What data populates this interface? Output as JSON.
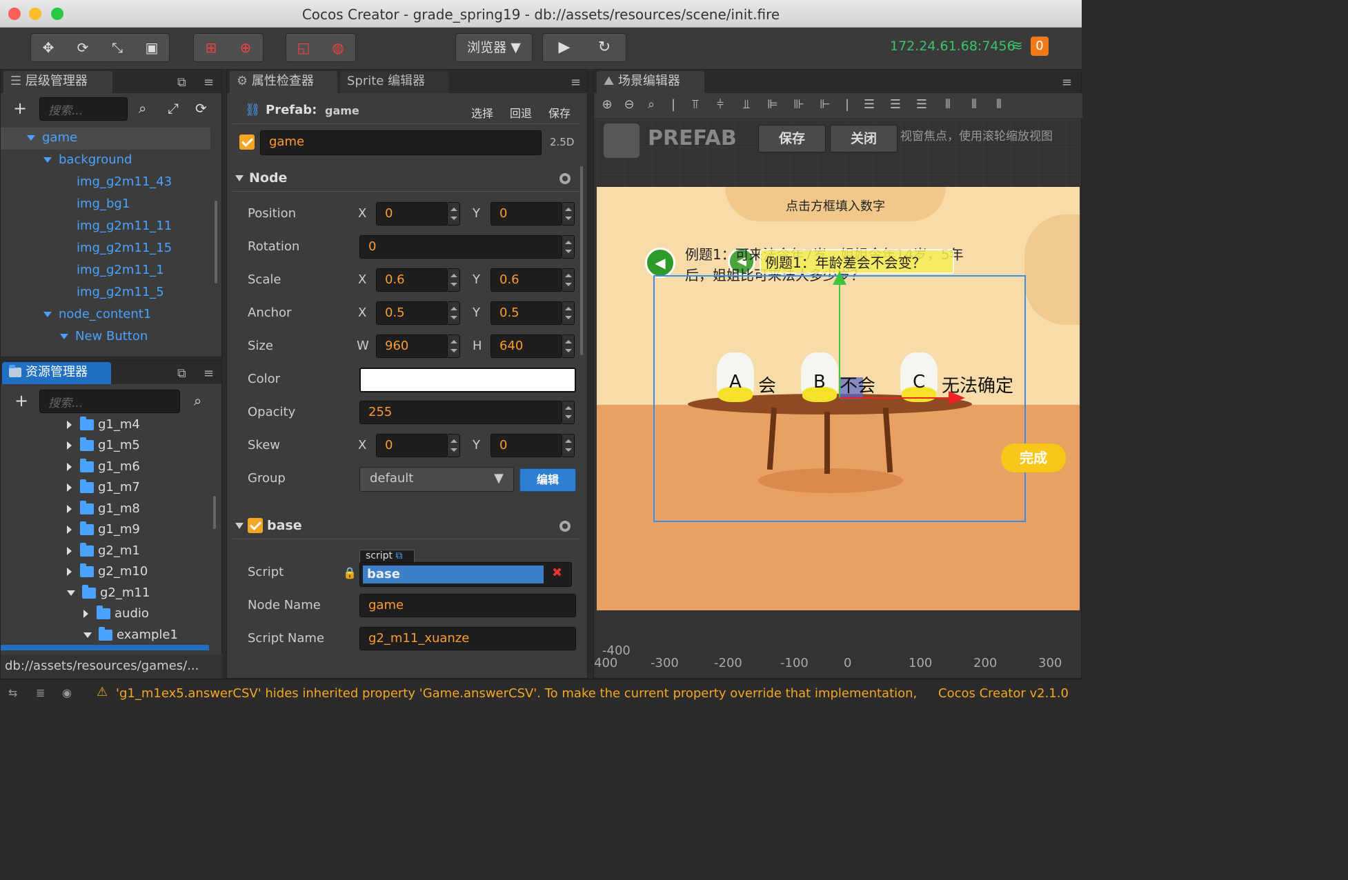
{
  "window": {
    "title": "Cocos Creator - grade_spring19 - db://assets/resources/scene/init.fire"
  },
  "toolbar": {
    "preview_select": "浏览器 ▼",
    "ip_address": "172.24.61.68:7456",
    "notification_count": "0"
  },
  "hierarchy": {
    "tab_label": "层级管理器",
    "search_placeholder": "搜索...",
    "items": [
      {
        "label": "game"
      },
      {
        "label": "background"
      },
      {
        "label": "img_g2m11_43"
      },
      {
        "label": "img_bg1"
      },
      {
        "label": "img_g2m11_11"
      },
      {
        "label": "img_g2m11_15"
      },
      {
        "label": "img_g2m11_1"
      },
      {
        "label": "img_g2m11_5"
      },
      {
        "label": "node_content1"
      },
      {
        "label": "New Button"
      }
    ]
  },
  "assets": {
    "tab_label": "资源管理器",
    "search_placeholder": "搜索...",
    "items": [
      {
        "label": "g1_m4"
      },
      {
        "label": "g1_m5"
      },
      {
        "label": "g1_m6"
      },
      {
        "label": "g1_m7"
      },
      {
        "label": "g1_m8"
      },
      {
        "label": "g1_m9"
      },
      {
        "label": "g2_m1"
      },
      {
        "label": "g2_m10"
      },
      {
        "label": "g2_m11"
      },
      {
        "label": "audio"
      },
      {
        "label": "example1"
      }
    ],
    "path": "db://assets/resources/games/..."
  },
  "inspector": {
    "tab_label": "属性检查器",
    "tab2_label": "Sprite 编辑器",
    "prefab_label": "Prefab:",
    "prefab_name": "game",
    "prefab_actions": {
      "select": "选择",
      "revert": "回退",
      "save": "保存"
    },
    "node_name": "game",
    "mode_25d": "2.5D",
    "node_section": "Node",
    "props": {
      "position": {
        "label": "Position",
        "x": "0",
        "y": "0"
      },
      "rotation": {
        "label": "Rotation",
        "value": "0"
      },
      "scale": {
        "label": "Scale",
        "x": "0.6",
        "y": "0.6"
      },
      "anchor": {
        "label": "Anchor",
        "x": "0.5",
        "y": "0.5"
      },
      "size": {
        "label": "Size",
        "w": "960",
        "h": "640"
      },
      "color": {
        "label": "Color",
        "value": "#ffffff"
      },
      "opacity": {
        "label": "Opacity",
        "value": "255"
      },
      "skew": {
        "label": "Skew",
        "x": "0",
        "y": "0"
      },
      "group": {
        "label": "Group",
        "value": "default",
        "edit": "编辑"
      }
    },
    "axis": {
      "x": "X",
      "y": "Y",
      "w": "W",
      "h": "H"
    },
    "base_section": "base",
    "script": {
      "label": "Script",
      "tag": "script",
      "value": "base"
    },
    "node_name_prop": {
      "label": "Node Name",
      "value": "game"
    },
    "script_name_prop": {
      "label": "Script Name",
      "value": "g2_m11_xuanze"
    }
  },
  "scene": {
    "tab_label": "场景编辑器",
    "prefab_banner": "PREFAB",
    "save": "保存",
    "close": "关闭",
    "hint": "视窗焦点，使用滚轮缩放视图",
    "game": {
      "header": "点击方框填入数字",
      "question_line1": "例题1：可来法今年7岁，姐姐今年14岁，5年",
      "question_line2": "后，姐姐比可来法大多少岁？",
      "overlay_text": "例题1：年龄差会不会变？",
      "option_a": "A",
      "option_a_text": "会",
      "option_b": "B",
      "option_b_text": "不会",
      "option_c": "C",
      "option_c_text": "无法确定",
      "done_button": "完成"
    },
    "ruler": {
      "y_label": "-400",
      "x_labels": [
        "400",
        "-300",
        "-200",
        "-100",
        "0",
        "100",
        "200",
        "300"
      ]
    }
  },
  "status": {
    "warning": "'g1_m1ex5.answerCSV' hides inherited property 'Game.answerCSV'. To make the current property override that implementation,",
    "version": "Cocos Creator v2.1.0"
  }
}
